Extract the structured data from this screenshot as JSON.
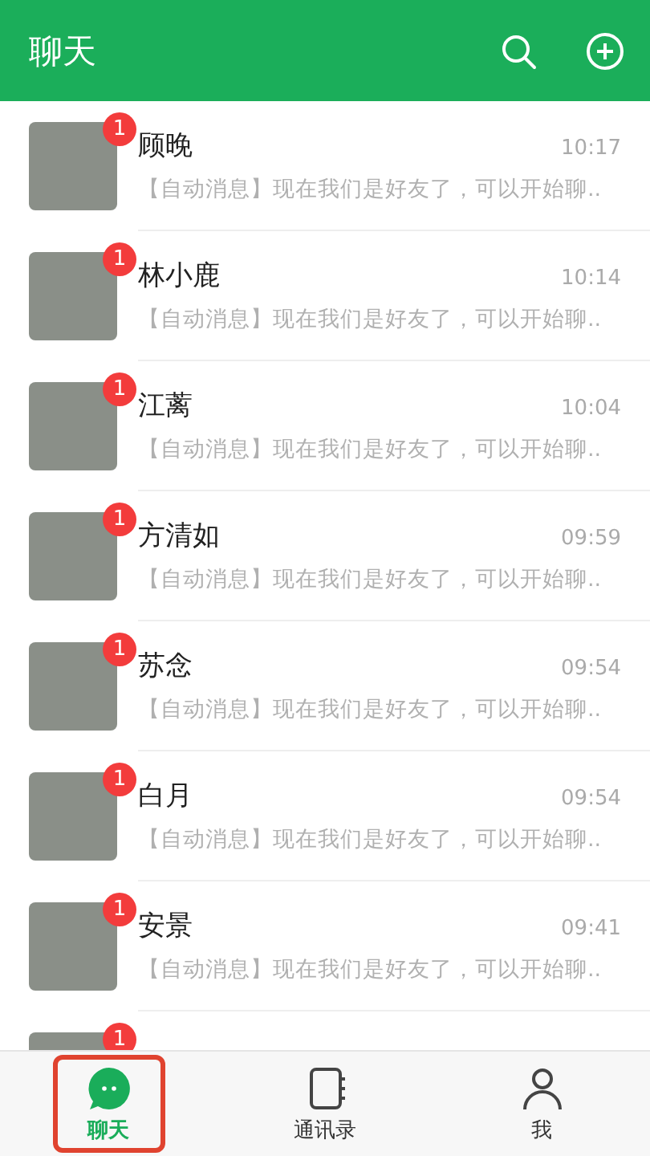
{
  "header": {
    "title": "聊天"
  },
  "chats": [
    {
      "name": "顾晚",
      "time": "10:17",
      "preview": "【自动消息】现在我们是好友了，可以开始聊..",
      "badge": "1"
    },
    {
      "name": "林小鹿",
      "time": "10:14",
      "preview": "【自动消息】现在我们是好友了，可以开始聊..",
      "badge": "1"
    },
    {
      "name": "江蓠",
      "time": "10:04",
      "preview": "【自动消息】现在我们是好友了，可以开始聊..",
      "badge": "1"
    },
    {
      "name": "方清如",
      "time": "09:59",
      "preview": "【自动消息】现在我们是好友了，可以开始聊..",
      "badge": "1"
    },
    {
      "name": "苏念",
      "time": "09:54",
      "preview": "【自动消息】现在我们是好友了，可以开始聊..",
      "badge": "1"
    },
    {
      "name": "白月",
      "time": "09:54",
      "preview": "【自动消息】现在我们是好友了，可以开始聊..",
      "badge": "1"
    },
    {
      "name": "安景",
      "time": "09:41",
      "preview": "【自动消息】现在我们是好友了，可以开始聊..",
      "badge": "1"
    },
    {
      "badge": "1"
    }
  ],
  "tabs": [
    {
      "label": "聊天",
      "kind": "chat",
      "selected": true,
      "highlighted": true
    },
    {
      "label": "通讯录",
      "kind": "contacts",
      "selected": false,
      "highlighted": false
    },
    {
      "label": "我",
      "kind": "me",
      "selected": false,
      "highlighted": false
    }
  ]
}
